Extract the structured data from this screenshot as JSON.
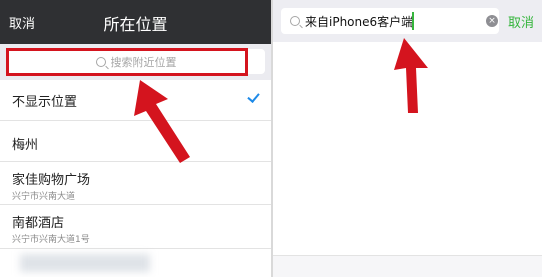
{
  "left": {
    "header": {
      "cancel_label": "取消",
      "title": "所在位置"
    },
    "search": {
      "placeholder": "搜索附近位置"
    },
    "locations": [
      {
        "name": "不显示位置",
        "address": "",
        "selected": true
      },
      {
        "name": "梅州",
        "address": "",
        "selected": false
      },
      {
        "name": "家佳购物广场",
        "address": "兴宁市兴南大道",
        "selected": false
      },
      {
        "name": "南都酒店",
        "address": "兴宁市兴南大道1号",
        "selected": false
      }
    ]
  },
  "right": {
    "search": {
      "value": "来自iPhone6客户端"
    },
    "cancel_label": "取消"
  },
  "colors": {
    "header_bg": "#2f3033",
    "annotation_red": "#d4141e",
    "wechat_green": "#35b53c",
    "check_blue": "#1e8ae8"
  },
  "icons": {
    "search": "magnifier-icon",
    "check": "checkmark-icon",
    "clear": "clear-x-icon",
    "arrow": "red-arrow-annotation"
  }
}
